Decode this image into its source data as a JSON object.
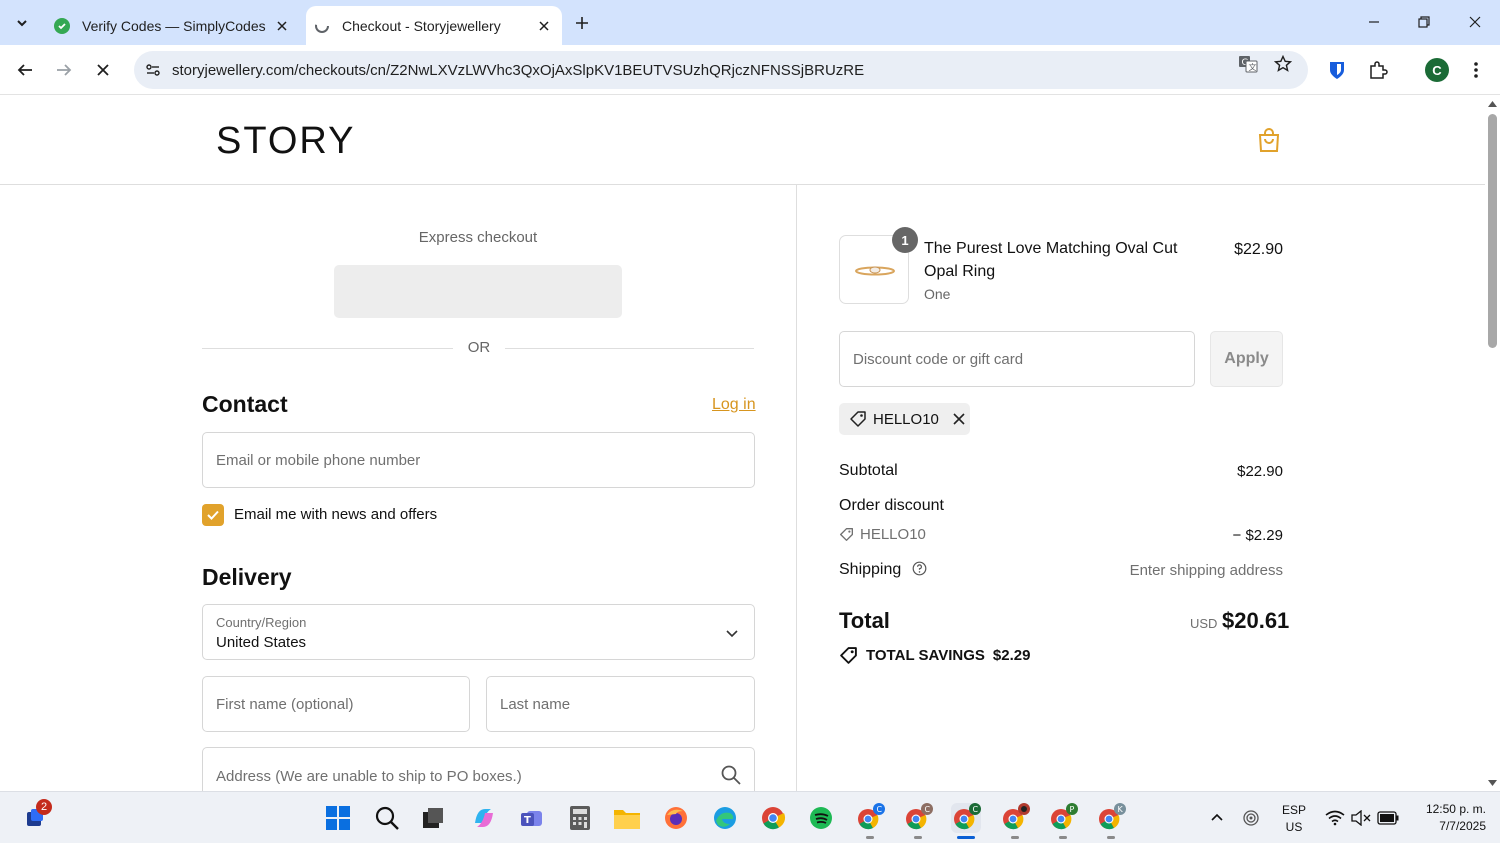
{
  "browser": {
    "tabs": [
      {
        "title": "Verify Codes — SimplyCodes",
        "active": false
      },
      {
        "title": "Checkout - Storyjewellery",
        "active": true
      }
    ],
    "url": "storyjewellery.com/checkouts/cn/Z2NwLXVzLWVhc3QxOjAxSlpKV1BEUTVSUzhQRjczNFNSSjBRUzRE",
    "profile_initial": "C"
  },
  "store": {
    "logo": "STORY"
  },
  "checkout": {
    "express_label": "Express checkout",
    "or_label": "OR",
    "contact": {
      "title": "Contact",
      "login_link": "Log in",
      "email_placeholder": "Email or mobile phone number",
      "newsletter_label": "Email me with news and offers",
      "newsletter_checked": true
    },
    "delivery": {
      "title": "Delivery",
      "country_label": "Country/Region",
      "country_value": "United States",
      "first_name_placeholder": "First name (optional)",
      "last_name_placeholder": "Last name",
      "address_placeholder": "Address (We are unable to ship to PO boxes.)"
    }
  },
  "summary": {
    "item": {
      "quantity": "1",
      "name": "The Purest Love Matching Oval Cut Opal Ring",
      "variant": "One",
      "price": "$22.90"
    },
    "discount_placeholder": "Discount code or gift card",
    "apply_label": "Apply",
    "applied_code": "HELLO10",
    "subtotal_label": "Subtotal",
    "subtotal_value": "$22.90",
    "order_discount_label": "Order discount",
    "discount_code": "HELLO10",
    "discount_value": "− $2.29",
    "shipping_label": "Shipping",
    "shipping_value": "Enter shipping address",
    "total_label": "Total",
    "currency": "USD",
    "total_value": "$20.61",
    "savings_label": "TOTAL SAVINGS",
    "savings_value": "$2.29"
  },
  "taskbar": {
    "notification_count": "2",
    "lang_line1": "ESP",
    "lang_line2": "US",
    "time": "12:50 p. m.",
    "date": "7/7/2025",
    "chrome_profiles": [
      "C",
      "C",
      "C",
      "",
      "P",
      "K"
    ]
  },
  "colors": {
    "accent": "#e1a22b",
    "link": "#d7951f",
    "chrome_tabbar": "#d3e3fd"
  }
}
